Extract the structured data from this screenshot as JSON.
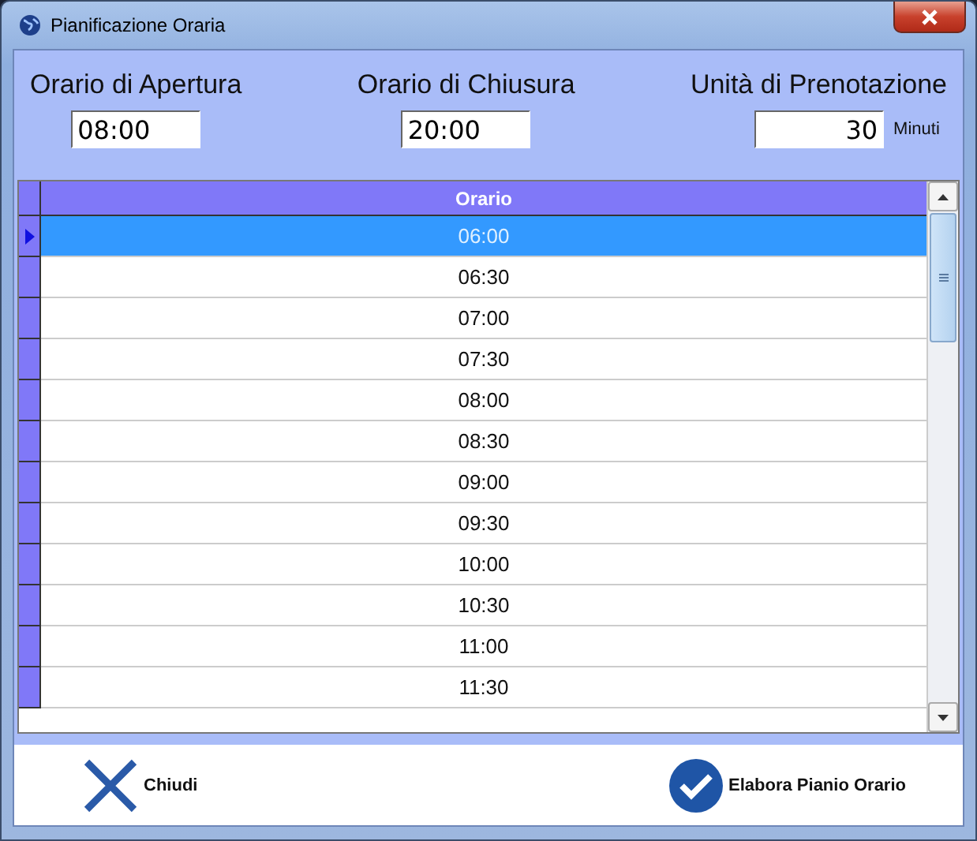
{
  "window": {
    "title": "Pianificazione Oraria"
  },
  "fields": [
    {
      "label": "Orario di Apertura",
      "value": "08:00"
    },
    {
      "label": "Orario di Chiusura",
      "value": "20:00"
    },
    {
      "label": "Unità di Prenotazione",
      "value": "30",
      "unit": "Minuti"
    }
  ],
  "table": {
    "columns": [
      "Orario"
    ],
    "rows": [
      {
        "cells": [
          "06:00"
        ],
        "selected": true
      },
      {
        "cells": [
          "06:30"
        ],
        "selected": false
      },
      {
        "cells": [
          "07:00"
        ],
        "selected": false
      },
      {
        "cells": [
          "07:30"
        ],
        "selected": false
      },
      {
        "cells": [
          "08:00"
        ],
        "selected": false
      },
      {
        "cells": [
          "08:30"
        ],
        "selected": false
      },
      {
        "cells": [
          "09:00"
        ],
        "selected": false
      },
      {
        "cells": [
          "09:30"
        ],
        "selected": false
      },
      {
        "cells": [
          "10:00"
        ],
        "selected": false
      },
      {
        "cells": [
          "10:30"
        ],
        "selected": false
      },
      {
        "cells": [
          "11:00"
        ],
        "selected": false
      },
      {
        "cells": [
          "11:30"
        ],
        "selected": false
      }
    ]
  },
  "buttons": [
    {
      "kind": "close",
      "label": "Chiudi"
    },
    {
      "kind": "confirm",
      "label": "Elabora Pianio Orario"
    }
  ]
}
